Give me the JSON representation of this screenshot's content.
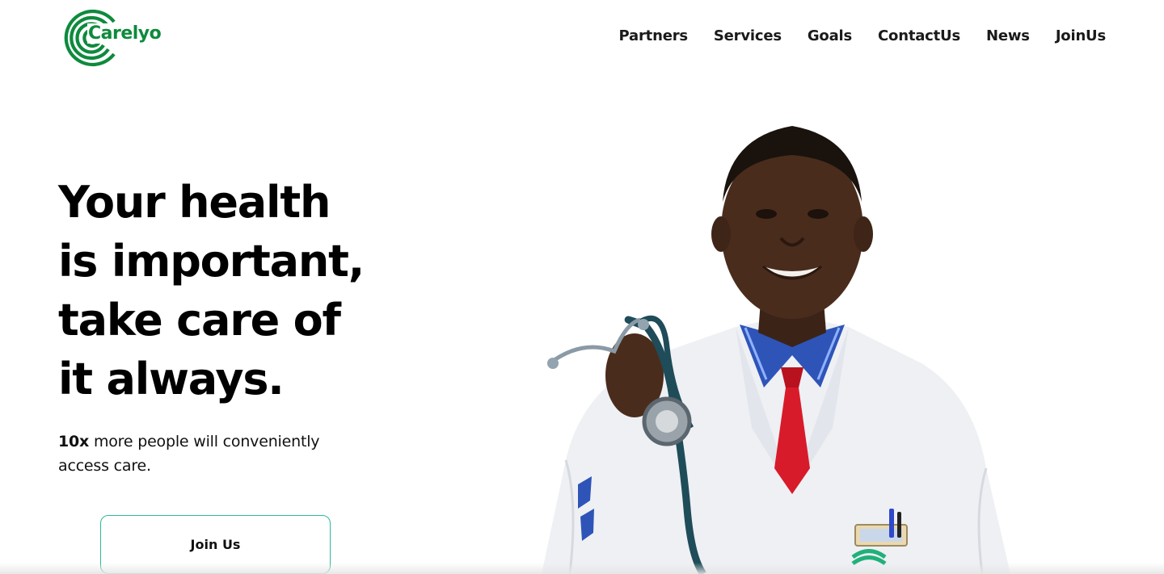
{
  "header": {
    "logo_text": "Carelyo",
    "nav": [
      {
        "label": "Partners"
      },
      {
        "label": "Services"
      },
      {
        "label": "Goals"
      },
      {
        "label": "ContactUs"
      },
      {
        "label": "News"
      },
      {
        "label": "JoinUs"
      }
    ]
  },
  "hero": {
    "title_lines": [
      "Your health",
      "is important,",
      "take care of",
      "it always."
    ],
    "subtitle_strong": "10x",
    "subtitle_rest": " more people will conveniently access care.",
    "cta_label": "Join Us",
    "image_icon": "doctor-with-stethoscope"
  },
  "colors": {
    "brand_green": "#0e8a3d",
    "button_border": "#2fb89a",
    "tie_red": "#d81b2a",
    "coat_white": "#eef0f4"
  }
}
